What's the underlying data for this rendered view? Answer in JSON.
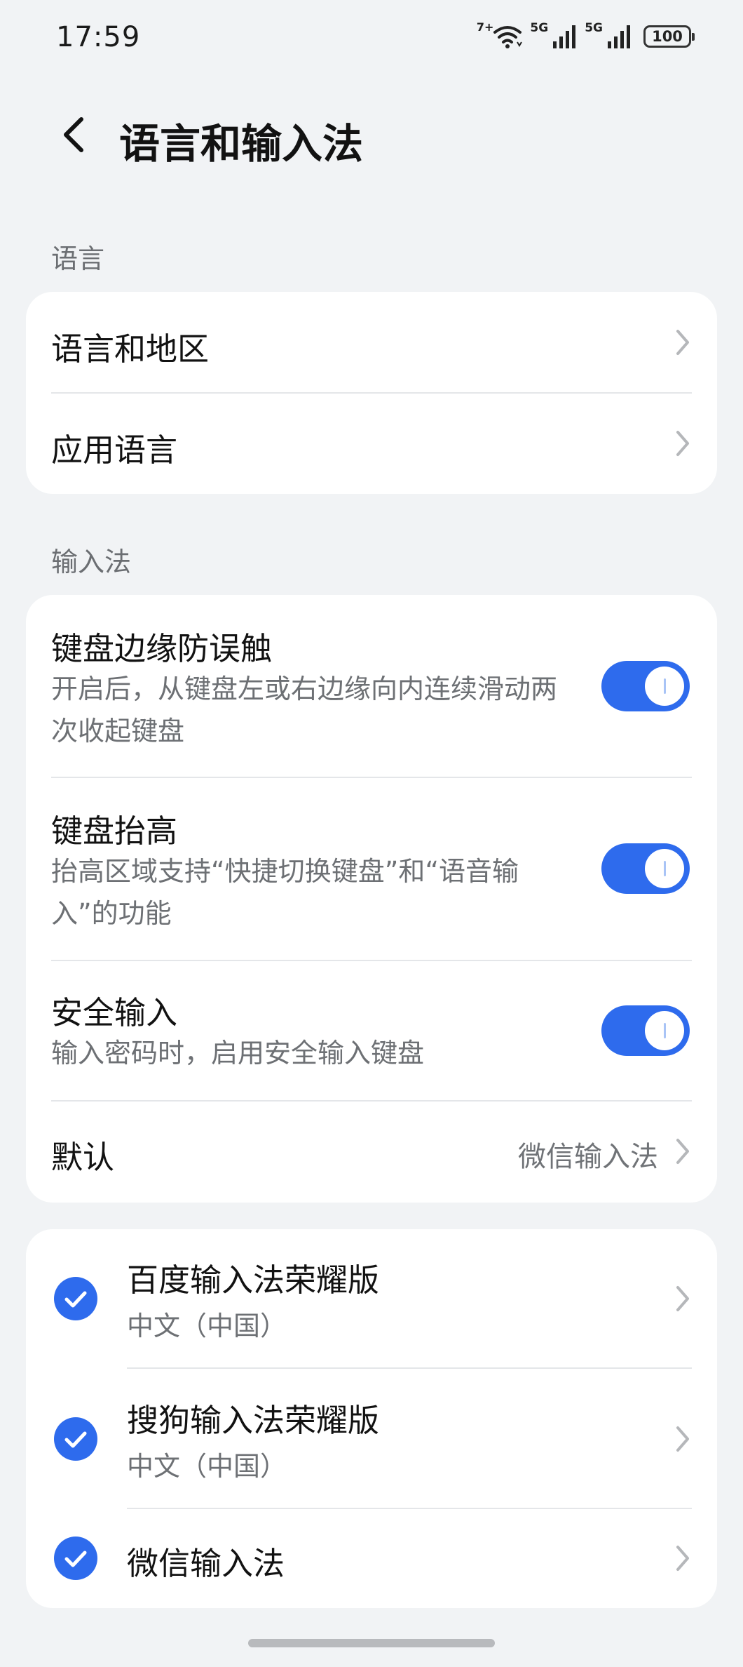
{
  "status_bar": {
    "time": "17:59",
    "wifi_badge": "7+",
    "sim1_label": "5G",
    "sim2_label": "5G",
    "battery": "100"
  },
  "header": {
    "title": "语言和输入法"
  },
  "language_section": {
    "label": "语言",
    "items": [
      {
        "title": "语言和地区"
      },
      {
        "title": "应用语言"
      }
    ]
  },
  "input_section": {
    "label": "输入法",
    "toggles": [
      {
        "title": "键盘边缘防误触",
        "desc": "开启后，从键盘左或右边缘向内连续滑动两次收起键盘",
        "on": true
      },
      {
        "title": "键盘抬高",
        "desc": "抬高区域支持“快捷切换键盘”和“语音输入”的功能",
        "on": true
      },
      {
        "title": "安全输入",
        "desc": "输入密码时，启用安全输入键盘",
        "on": true
      }
    ],
    "default_row": {
      "title": "默认",
      "value": "微信输入法"
    }
  },
  "ime_list": [
    {
      "name": "百度输入法荣耀版",
      "lang": "中文（中国）",
      "checked": true
    },
    {
      "name": "搜狗输入法荣耀版",
      "lang": "中文（中国）",
      "checked": true
    },
    {
      "name": "微信输入法",
      "lang": "",
      "checked": true
    }
  ],
  "colors": {
    "accent": "#2e6bed",
    "background": "#f1f3f5",
    "card": "#ffffff",
    "secondary_text": "#6d7074"
  }
}
